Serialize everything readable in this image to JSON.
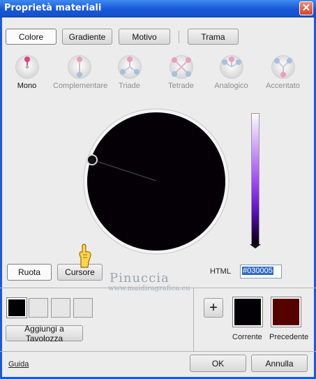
{
  "window": {
    "title": "Proprietà materiali",
    "close_glyph": "✕"
  },
  "tabs": [
    {
      "label": "Colore",
      "active": true
    },
    {
      "label": "Gradiente",
      "active": false
    },
    {
      "label": "Motivo",
      "active": false
    },
    {
      "label": "Trama",
      "active": false
    }
  ],
  "harmonies": [
    {
      "label": "Mono",
      "selected": true,
      "icon": "mono-harmony-icon"
    },
    {
      "label": "Complementare",
      "selected": false,
      "icon": "complementary-harmony-icon"
    },
    {
      "label": "Triade",
      "selected": false,
      "icon": "triad-harmony-icon"
    },
    {
      "label": "Tetrade",
      "selected": false,
      "icon": "tetrad-harmony-icon"
    },
    {
      "label": "Analogico",
      "selected": false,
      "icon": "analogous-harmony-icon"
    },
    {
      "label": "Accentato",
      "selected": false,
      "icon": "accented-harmony-icon"
    }
  ],
  "mode_buttons": {
    "wheel": "Ruota",
    "cursor": "Cursore"
  },
  "html_field": {
    "label": "HTML",
    "value": "#030005"
  },
  "watermark": {
    "name": "Pinuccia",
    "url": "www.maidiragrafica.eu"
  },
  "palette": {
    "add_button": "Aggiungi a Tavolozza",
    "plus_glyph": "+"
  },
  "current": {
    "label": "Corrente",
    "color": "#030005"
  },
  "previous": {
    "label": "Precedente",
    "color": "#560000"
  },
  "footer": {
    "help": "Guida",
    "ok": "OK",
    "cancel": "Annulla"
  },
  "colors": {
    "title_bar": "#1758d8",
    "accent": "#316ac5",
    "harmony_pink": "#e0407a",
    "harmony_grey_pink": "#e7a0bd",
    "harmony_blue": "#a7c1dc"
  }
}
